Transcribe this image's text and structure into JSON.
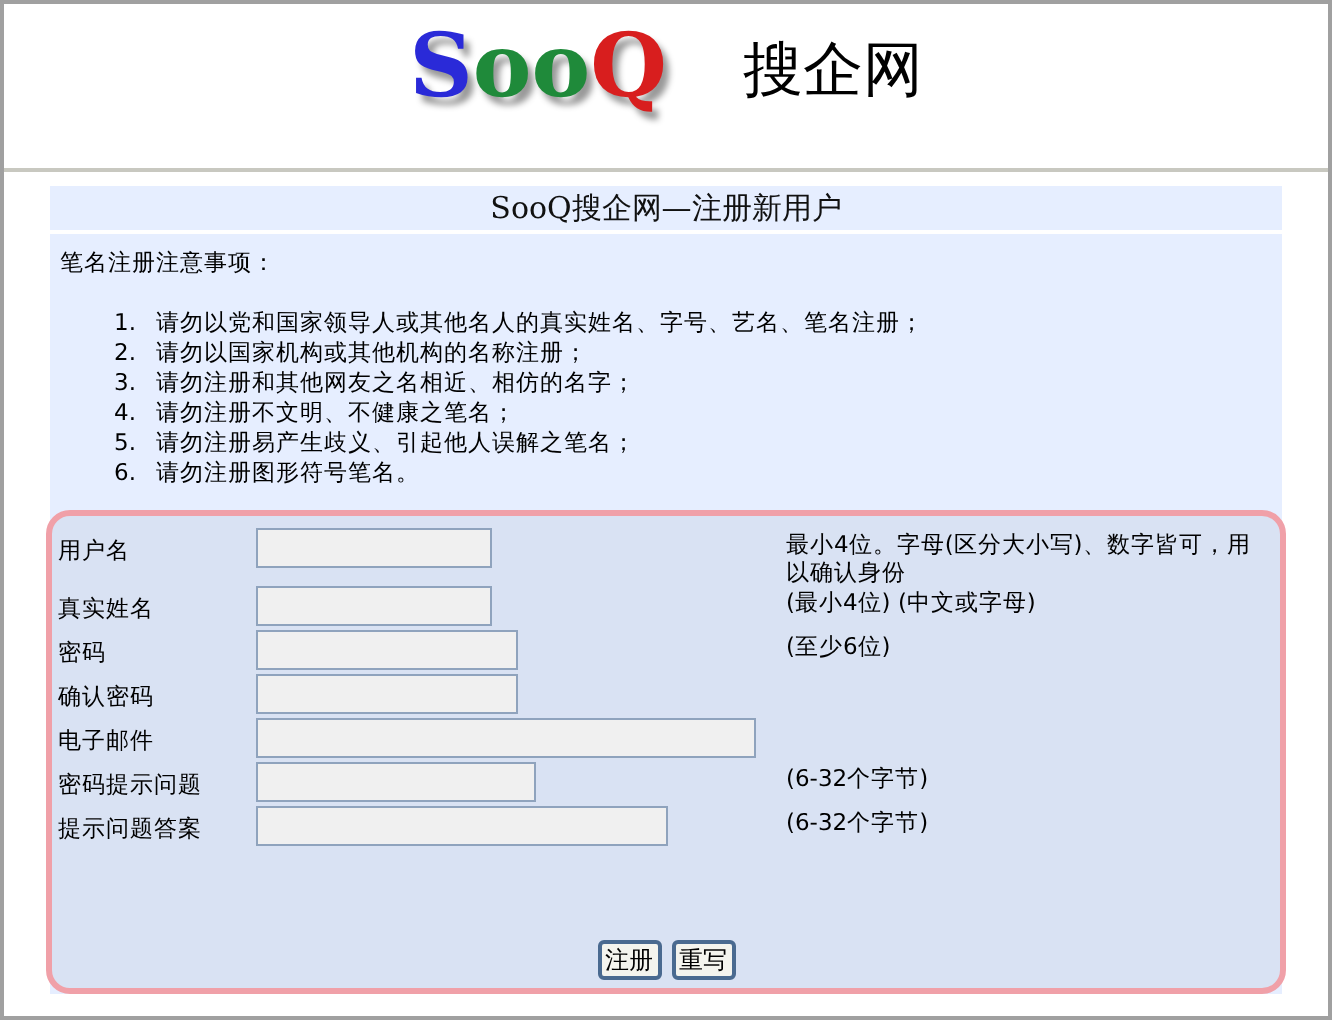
{
  "logo": {
    "letters": [
      {
        "char": "S",
        "color": "#2a2ad8"
      },
      {
        "char": "o",
        "color": "#1f8a3a"
      },
      {
        "char": "o",
        "color": "#1f8a3a"
      },
      {
        "char": "Q",
        "color": "#d81e1e"
      }
    ],
    "site_name": "搜企网"
  },
  "page_title": "SooQ搜企网—注册新用户",
  "notes": {
    "heading": "笔名注册注意事项：",
    "items": [
      {
        "number": "1.",
        "text": "请勿以党和国家领导人或其他名人的真实姓名、字号、艺名、笔名注册；"
      },
      {
        "number": "2.",
        "text": "请勿以国家机构或其他机构的名称注册；"
      },
      {
        "number": "3.",
        "text": "请勿注册和其他网友之名相近、相仿的名字；"
      },
      {
        "number": "4.",
        "text": "请勿注册不文明、不健康之笔名；"
      },
      {
        "number": "5.",
        "text": "请勿注册易产生歧义、引起他人误解之笔名；"
      },
      {
        "number": "6.",
        "text": "请勿注册图形符号笔名。"
      }
    ]
  },
  "form": {
    "fields": [
      {
        "label": "用户名",
        "hint": "最小4位。字母(区分大小写)、数字皆可，用以确认身份"
      },
      {
        "label": "真实姓名",
        "hint": "(最小4位) (中文或字母)"
      },
      {
        "label": "密码",
        "hint": "(至少6位)"
      },
      {
        "label": "确认密码"
      },
      {
        "label": "电子邮件"
      },
      {
        "label": "密码提示问题",
        "hint": "(6-32个字节)"
      },
      {
        "label": "提示问题答案",
        "hint": "(6-32个字节)"
      }
    ],
    "buttons": [
      "注册",
      "重写"
    ]
  }
}
